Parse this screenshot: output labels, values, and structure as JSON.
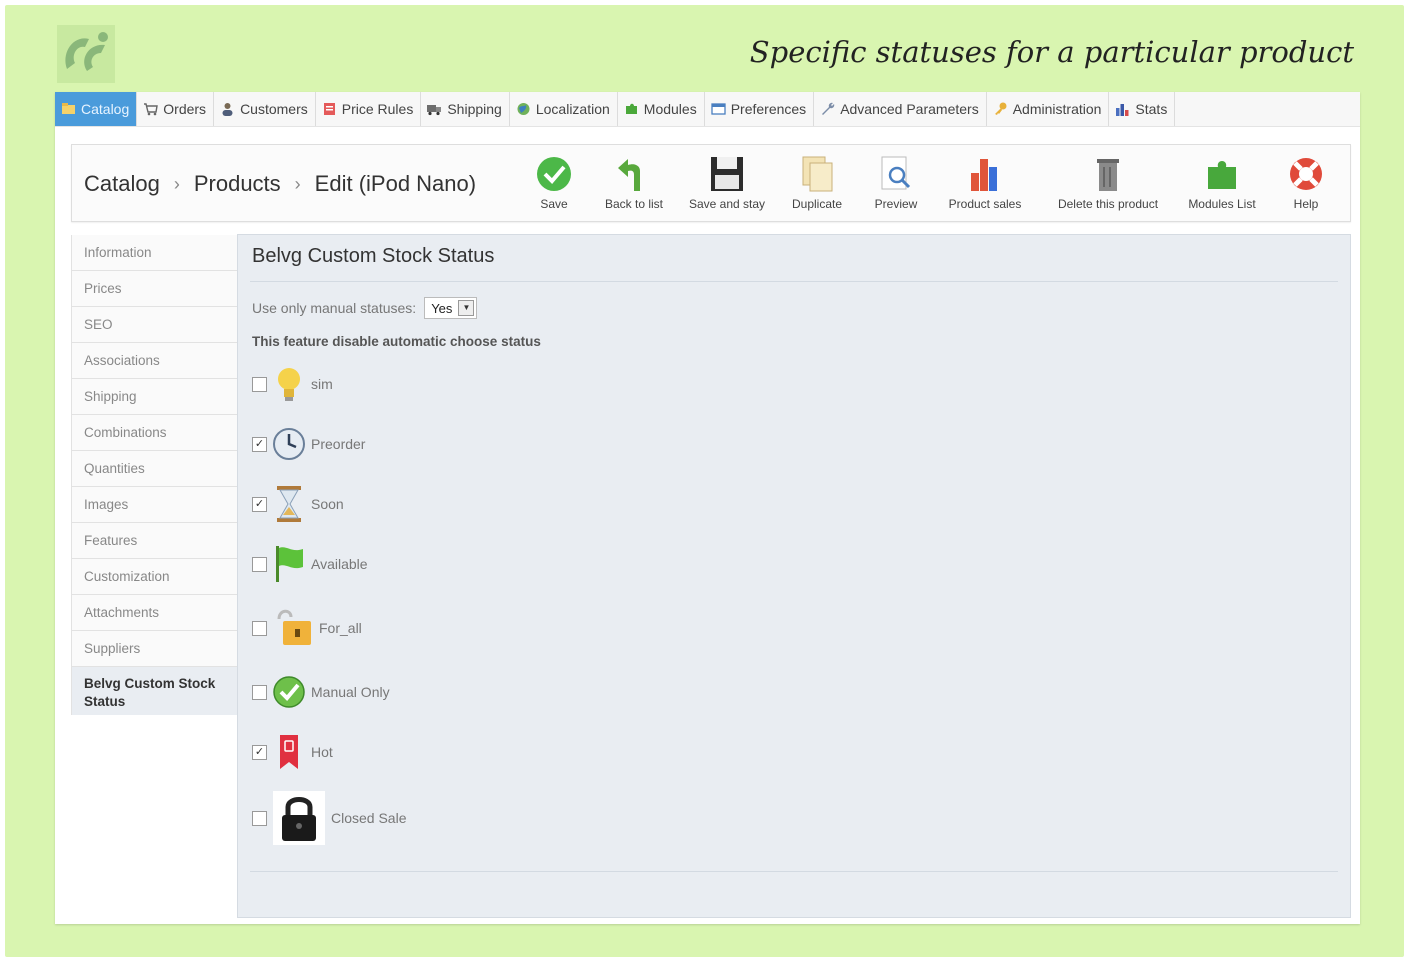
{
  "page_heading": "Specific statuses for a particular product",
  "top_menu": [
    {
      "label": "Catalog",
      "icon": "catalog-icon",
      "active": true
    },
    {
      "label": "Orders",
      "icon": "orders-icon"
    },
    {
      "label": "Customers",
      "icon": "customers-icon"
    },
    {
      "label": "Price Rules",
      "icon": "price-rules-icon"
    },
    {
      "label": "Shipping",
      "icon": "truck-icon"
    },
    {
      "label": "Localization",
      "icon": "globe-icon"
    },
    {
      "label": "Modules",
      "icon": "puzzle-icon"
    },
    {
      "label": "Preferences",
      "icon": "preferences-icon"
    },
    {
      "label": "Advanced Parameters",
      "icon": "wrench-icon"
    },
    {
      "label": "Administration",
      "icon": "key-icon"
    },
    {
      "label": "Stats",
      "icon": "stats-icon"
    }
  ],
  "breadcrumb": {
    "level1": "Catalog",
    "level2": "Products",
    "level3": "Edit (iPod Nano)"
  },
  "toolbar": [
    {
      "label": "Save",
      "icon": "save-check-icon"
    },
    {
      "label": "Back to list",
      "icon": "back-arrow-icon"
    },
    {
      "label": "Save and stay",
      "icon": "floppy-disk-icon"
    },
    {
      "label": "Duplicate",
      "icon": "duplicate-icon"
    },
    {
      "label": "Preview",
      "icon": "magnifier-icon"
    },
    {
      "label": "Product sales",
      "icon": "bar-chart-icon"
    },
    {
      "label": "Delete this product",
      "icon": "trash-icon"
    },
    {
      "label": "Modules List",
      "icon": "puzzle-icon"
    },
    {
      "label": "Help",
      "icon": "lifebuoy-icon"
    }
  ],
  "side_tabs": [
    "Information",
    "Prices",
    "SEO",
    "Associations",
    "Shipping",
    "Combinations",
    "Quantities",
    "Images",
    "Features",
    "Customization",
    "Attachments",
    "Suppliers"
  ],
  "side_tab_active": "Belvg Custom Stock Status",
  "panel": {
    "title": "Belvg Custom Stock Status",
    "manual_label": "Use only manual statuses:",
    "manual_value": "Yes",
    "note": "This feature disable automatic choose status"
  },
  "statuses": [
    {
      "label": "sim",
      "checked": false,
      "icon": "lightbulb-icon"
    },
    {
      "label": "Preorder",
      "checked": true,
      "icon": "clock-icon"
    },
    {
      "label": "Soon",
      "checked": true,
      "icon": "hourglass-icon"
    },
    {
      "label": "Available",
      "checked": false,
      "icon": "green-flag-icon"
    },
    {
      "label": "For_all",
      "checked": false,
      "icon": "open-lock-folder-icon"
    },
    {
      "label": "Manual Only",
      "checked": false,
      "icon": "green-check-icon"
    },
    {
      "label": "Hot",
      "checked": false,
      "icon": "red-bookmark-icon"
    },
    {
      "label": "Closed Sale",
      "checked": false,
      "icon": "padlock-icon"
    }
  ],
  "colors": {
    "frame": "#d9f5b0",
    "active_tab": "#4a9bdb",
    "panel": "#e9edf2"
  }
}
